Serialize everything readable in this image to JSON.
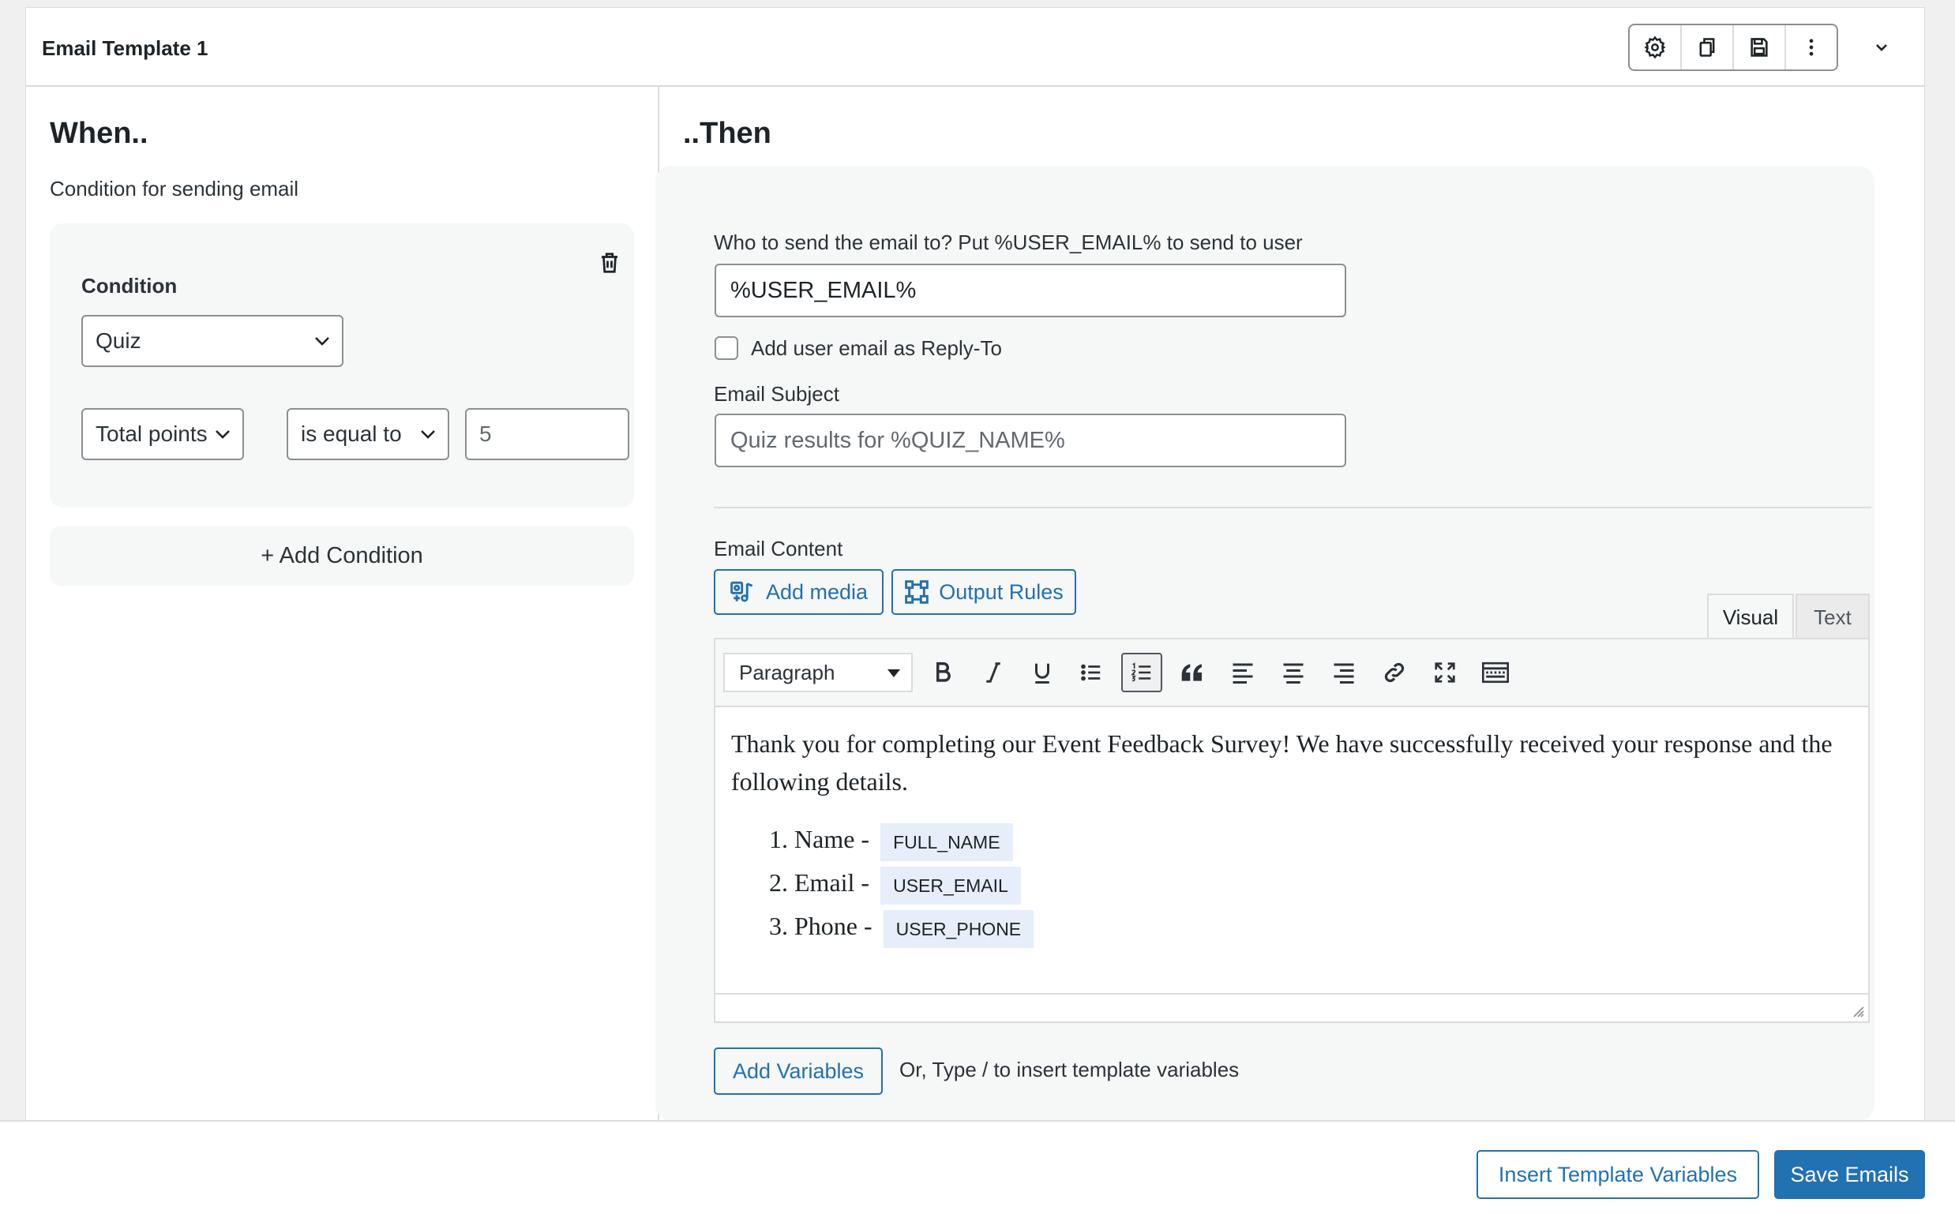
{
  "header": {
    "title": "Email Template 1",
    "icons": [
      "gear-icon",
      "duplicate-icon",
      "save-icon",
      "kebab-icon",
      "chevron-down-icon"
    ]
  },
  "when": {
    "heading": "When..",
    "subtitle": "Condition for sending email",
    "condition": {
      "label": "Condition",
      "source_select": "Quiz",
      "field_select": "Total points",
      "operator_select": "is equal to",
      "value": "5"
    },
    "add_condition": "+ Add Condition"
  },
  "then": {
    "heading": "..Then",
    "recipient_label": "Who to send the email to? Put %USER_EMAIL% to send to user",
    "recipient_value": "%USER_EMAIL%",
    "reply_to_label": "Add user email as Reply-To",
    "reply_to_checked": false,
    "subject_label": "Email Subject",
    "subject_placeholder": "Quiz results for %QUIZ_NAME%",
    "content_label": "Email Content",
    "add_media": "Add media",
    "output_rules": "Output Rules",
    "tabs": {
      "visual": "Visual",
      "text": "Text"
    },
    "toolbar": {
      "format": "Paragraph"
    },
    "editor": {
      "paragraph": "Thank you for completing our Event Feedback Survey! We have successfully received your response and the following details.",
      "items": [
        {
          "label": "Name -",
          "variable": "FULL_NAME"
        },
        {
          "label": "Email -",
          "variable": "USER_EMAIL"
        },
        {
          "label": "Phone -",
          "variable": "USER_PHONE"
        }
      ]
    },
    "add_variables": "Add Variables",
    "variables_hint": "Or, Type / to insert template variables"
  },
  "footer": {
    "insert_template_variables": "Insert Template Variables",
    "save_emails": "Save Emails"
  },
  "colors": {
    "accent": "#2271b1",
    "chip": "#e5eefa",
    "border": "#8c8f94"
  }
}
